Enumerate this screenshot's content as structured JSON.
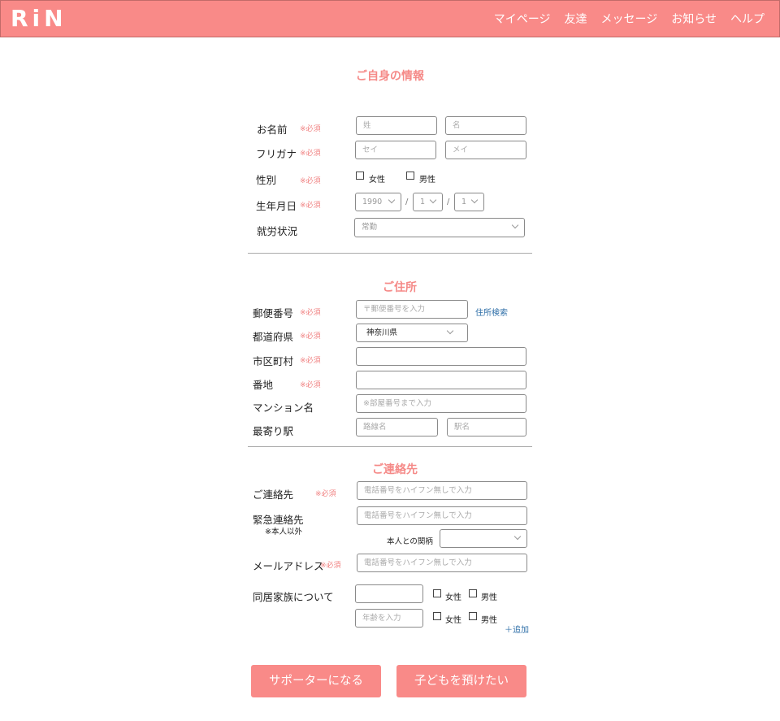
{
  "header": {
    "logo": "RiN",
    "nav": [
      "マイページ",
      "友達",
      "メッセージ",
      "お知らせ",
      "ヘルプ"
    ]
  },
  "required_mark": "※必須",
  "profile": {
    "title": "ご自身の情報",
    "name_label": "お名前",
    "last_name_placeholder": "姓",
    "first_name_placeholder": "名",
    "kana_label": "フリガナ",
    "last_kana_placeholder": "セイ",
    "first_kana_placeholder": "メイ",
    "gender_label": "性別",
    "female": "女性",
    "male": "男性",
    "birth_label": "生年月日",
    "birth_year": "1990",
    "birth_month": "1",
    "birth_day": "1",
    "separator": "/",
    "employment_label": "就労状況",
    "employment_value": "常勤"
  },
  "address": {
    "title": "ご住所",
    "postal_label": "郵便番号",
    "postal_placeholder": "〒郵便番号を入力",
    "postal_search": "住所検索",
    "prefecture_label": "都道府県",
    "prefecture_value": "神奈川県",
    "city_label": "市区町村",
    "street_label": "番地",
    "building_label": "マンション名",
    "building_placeholder": "※部屋番号まで入力",
    "station_label": "最寄り駅",
    "line_placeholder": "路線名",
    "station_placeholder": "駅名"
  },
  "contact": {
    "title": "ご連絡先",
    "phone_label": "ご連絡先",
    "phone_placeholder": "電話番号をハイフン無しで入力",
    "emergency_label": "緊急連絡先",
    "emergency_note": "※本人以外",
    "emergency_placeholder": "電話番号をハイフン無しで入力",
    "relation_label": "本人との関柄",
    "email_label": "メールアドレス",
    "email_placeholder": "電話番号をハイフン無しで入力",
    "family_label": "同居家族について",
    "age_placeholder": "年齢を入力",
    "female": "女性",
    "male": "男性",
    "add_link": "＋追加"
  },
  "buttons": {
    "supporter": "サポーターになる",
    "entrust": "子どもを預けたい"
  }
}
